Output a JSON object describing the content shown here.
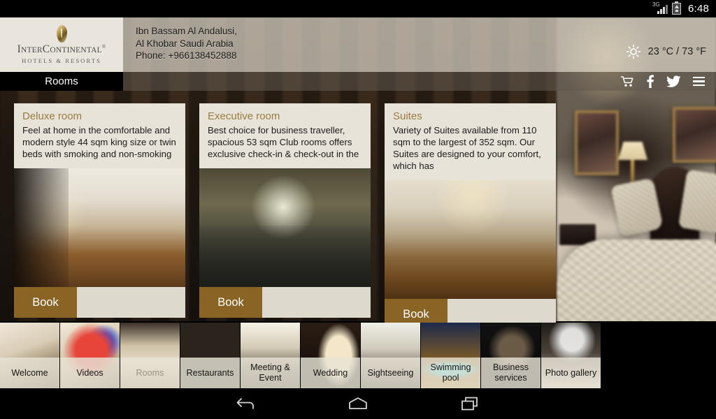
{
  "statusbar": {
    "network_label": "3G",
    "clock": "6:48",
    "network_icon": "signal-3g-icon",
    "battery_icon": "battery-charging-icon"
  },
  "header": {
    "brand": {
      "name_part1": "I",
      "name_part2": "NTER",
      "name_part3": "C",
      "name_part4": "ONTINENTAL",
      "registered": "®",
      "tagline": "HOTELS & RESORTS"
    },
    "address": {
      "line1": "Ibn Bassam Al Andalusi,",
      "line2": "Al Khobar Saudi Arabia",
      "line3": "Phone: +966138452888"
    },
    "weather": {
      "icon": "sun-icon",
      "reading": "23 °C / 73 °F"
    }
  },
  "page_title": "Rooms",
  "social": [
    {
      "name": "cart-icon",
      "glyph": "🛒"
    },
    {
      "name": "facebook-icon",
      "glyph": "f"
    },
    {
      "name": "twitter-icon",
      "glyph": "🐦"
    },
    {
      "name": "menu-icon",
      "glyph": "☰"
    }
  ],
  "cards": [
    {
      "title": "Deluxe room",
      "description": "Feel at home in the comfortable and modern style 44 sqm king size or twin beds with smoking and non-smoking",
      "book_label": "Book",
      "photo": "deluxe-room-photo"
    },
    {
      "title": "Executive room",
      "description": "Best choice for business traveller, spacious 53 sqm Club rooms offers exclusive check-in & check-out in the",
      "book_label": "Book",
      "photo": "executive-room-photo"
    },
    {
      "title": "Suites",
      "description": "Variety of Suites available from 110 sqm to the largest of 352 sqm. Our Suites are designed to your comfort, which has",
      "book_label": "Book",
      "photo": "suites-photo"
    }
  ],
  "thumbnails": [
    {
      "label": "Welcome",
      "active": false
    },
    {
      "label": "Videos",
      "active": false
    },
    {
      "label": "Rooms",
      "active": true
    },
    {
      "label": "Restaurants",
      "active": false
    },
    {
      "label": "Meeting & Event",
      "active": false
    },
    {
      "label": "Wedding",
      "active": false
    },
    {
      "label": "Sightseeing",
      "active": false
    },
    {
      "label": "Swimming pool",
      "active": false
    },
    {
      "label": "Business services",
      "active": false
    },
    {
      "label": "Photo gallery",
      "active": false
    }
  ],
  "navbar": [
    {
      "name": "back-button"
    },
    {
      "name": "home-button"
    },
    {
      "name": "recents-button"
    }
  ],
  "colors": {
    "brand_gold": "#9a7c42",
    "book_button": "#8a6424",
    "card_panel": "#e7e3d8",
    "logo_panel": "#e9e5dd",
    "title_tab": "#000000"
  }
}
